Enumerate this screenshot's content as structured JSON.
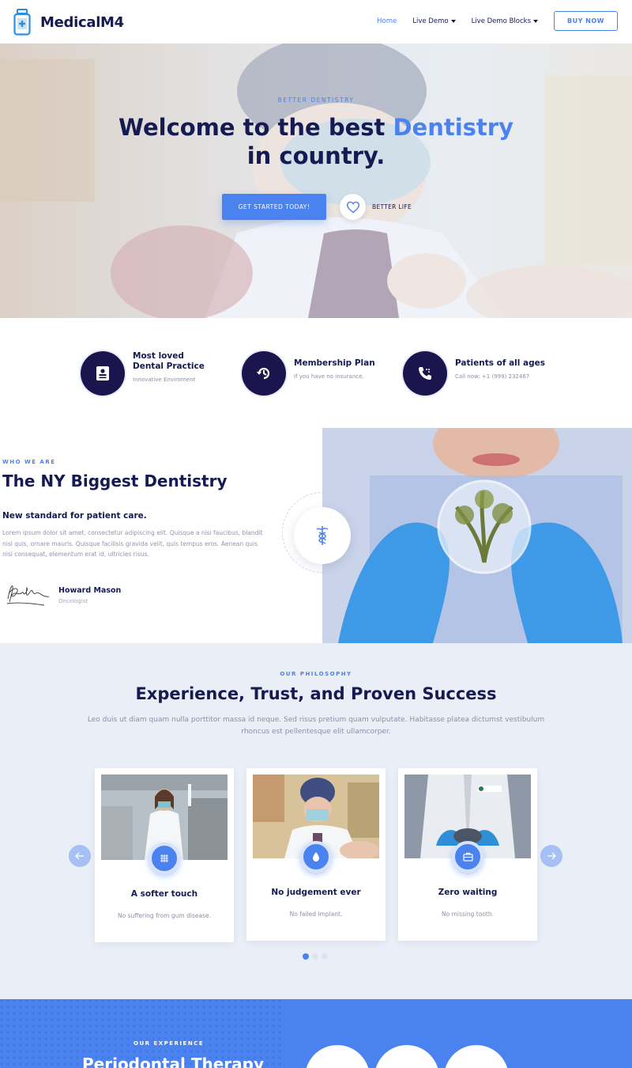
{
  "header": {
    "logo_text": "MedicalM4",
    "nav": [
      {
        "label": "Home",
        "active": true
      },
      {
        "label": "Live Demo",
        "dropdown": true
      },
      {
        "label": "Live Demo Blocks",
        "dropdown": true
      }
    ],
    "buy_label": "BUY NOW"
  },
  "hero": {
    "kicker": "BETTER DENTISTRY",
    "title_part1": "Welcome to the best ",
    "title_accent": "Dentistry",
    "title_part2": "in country.",
    "cta_label": "GET STARTED TODAY!",
    "heart_label": "BETTER LIFE"
  },
  "features": [
    {
      "title": "Most loved Dental Practice",
      "sub": "Innovative Enviroment",
      "icon": "id-card-icon"
    },
    {
      "title": "Membership Plan",
      "sub": "If you have no insurance.",
      "icon": "history-icon"
    },
    {
      "title": "Patients of all ages",
      "sub": "Call now: +1 (999) 232467",
      "icon": "phone-icon"
    }
  ],
  "who": {
    "kicker": "WHO WE ARE",
    "title": "The NY Biggest Dentistry",
    "sub": "New standard for patient care.",
    "body": "Lorem ipsum dolor sit amet, consectetur adipiscing elit. Quisque a nisi faucibus, blandit nisl quis, ornare mauris. Quisque facilisis gravida velit, quis tempus eros. Aenean quis nisi consequat, elementum erat id, ultricies risus.",
    "author_name": "Howard Mason",
    "author_role": "Oncologist"
  },
  "philosophy": {
    "kicker": "OUR PHILOSOPHY",
    "title": "Experience, Trust, and Proven Success",
    "body": "Leo duis ut diam quam nulla porttitor massa id neque. Sed risus pretium quam vulputate. Habitasse platea dictumst vestibulum rhoncus est pellentesque elit ullamcorper.",
    "cards": [
      {
        "title": "A softer touch",
        "sub": "No suffering from gum disease.",
        "icon": "grid-icon"
      },
      {
        "title": "No judgement ever",
        "sub": "No failed implant.",
        "icon": "drop-icon"
      },
      {
        "title": "Zero waiting",
        "sub": "No missing tooth.",
        "icon": "medical-kit-icon"
      }
    ],
    "active_slide": 1,
    "slide_count": 3
  },
  "experience": {
    "kicker": "OUR EXPERIENCE",
    "title": "Periodontal Therapy"
  },
  "colors": {
    "accent": "#4a82f0",
    "navy": "#151a52",
    "dark_circle": "#1b154d"
  }
}
